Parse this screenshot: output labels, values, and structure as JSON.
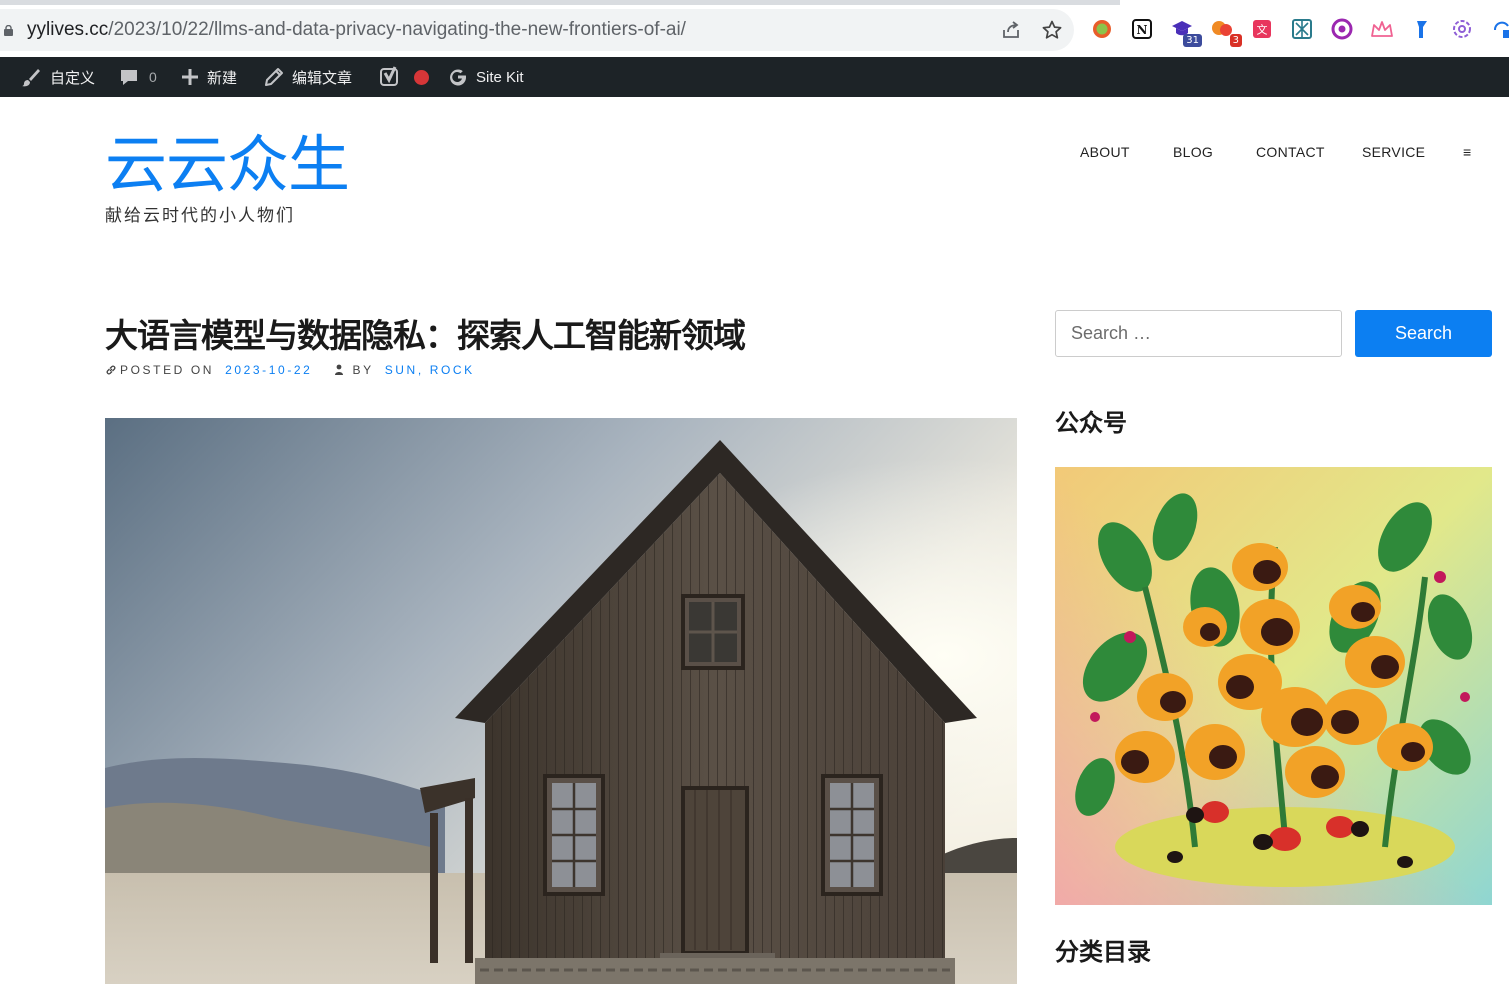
{
  "browser": {
    "url_host": "yylives.cc",
    "url_path": "/2023/10/22/llms-and-data-privacy-navigating-the-new-frontiers-of-ai/",
    "extensions": [
      {
        "name": "circle-extension-icon",
        "badge": ""
      },
      {
        "name": "notion-icon",
        "badge": ""
      },
      {
        "name": "graduation-cap-extension-icon",
        "badge": "31"
      },
      {
        "name": "bubbles-extension-icon",
        "badge": "3"
      },
      {
        "name": "translate-extension-icon",
        "badge": ""
      },
      {
        "name": "grid-extension-icon",
        "badge": ""
      },
      {
        "name": "purple-circle-extension-icon",
        "badge": ""
      },
      {
        "name": "crown-extension-icon",
        "badge": ""
      },
      {
        "name": "blue-flag-extension-icon",
        "badge": ""
      },
      {
        "name": "openai-icon",
        "badge": ""
      },
      {
        "name": "sync-extension-icon",
        "badge": ""
      }
    ]
  },
  "admin_bar": {
    "customize": "自定义",
    "comments_count": "0",
    "new": "新建",
    "edit_post": "编辑文章",
    "site_kit": "Site Kit"
  },
  "header": {
    "site_title": "云云众生",
    "site_description": "献给云时代的小人物们",
    "nav": [
      {
        "label": "ABOUT"
      },
      {
        "label": "BLOG"
      },
      {
        "label": "CONTACT"
      },
      {
        "label": "SERVICE"
      },
      {
        "label": "≡"
      }
    ]
  },
  "post": {
    "title": "大语言模型与数据隐私：探索人工智能新领域",
    "posted_on_label": "POSTED ON",
    "date": "2023-10-22",
    "by_label": "BY",
    "author": "SUN, ROCK"
  },
  "sidebar": {
    "search_placeholder": "Search …",
    "search_button": "Search",
    "widget1_title": "公众号",
    "widget2_title": "分类目录"
  },
  "colors": {
    "accent": "#0c7ff2",
    "admin_bar": "#1d2327"
  }
}
